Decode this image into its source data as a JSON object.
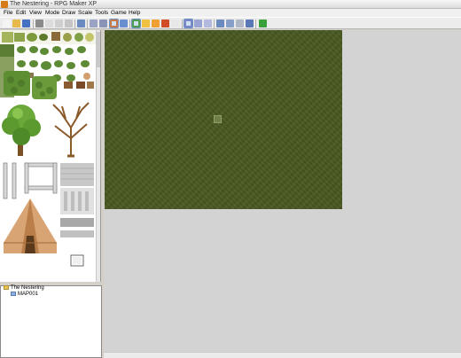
{
  "window": {
    "title": "The Nestering - RPG Maker XP"
  },
  "menu": [
    "File",
    "Edit",
    "View",
    "Mode",
    "Draw",
    "Scale",
    "Tools",
    "Game",
    "Help"
  ],
  "toolbar": {
    "buttons": [
      {
        "name": "new-project-icon",
        "color": "#f4f4f4"
      },
      {
        "name": "open-project-icon",
        "color": "#e7b84a"
      },
      {
        "name": "save-project-icon",
        "color": "#4670c0"
      },
      {
        "name": "cut-icon",
        "color": "#8a8a8a"
      },
      {
        "name": "copy-icon",
        "color": "#dcdcdc"
      },
      {
        "name": "paste-icon",
        "color": "#cfcfcf"
      },
      {
        "name": "delete-icon",
        "color": "#c4c4c4"
      },
      {
        "name": "undo-icon",
        "color": "#6a8bc0"
      },
      {
        "name": "layer1-icon",
        "color": "#9aa3c4"
      },
      {
        "name": "layer2-icon",
        "color": "#8a94b8"
      },
      {
        "name": "layer3-icon",
        "color": "#c87848"
      },
      {
        "name": "events-icon",
        "color": "#6a8fd0"
      },
      {
        "name": "pencil-icon",
        "color": "#4f9e4f"
      },
      {
        "name": "rectangle-icon",
        "color": "#f0c040"
      },
      {
        "name": "ellipse-icon",
        "color": "#f0a030"
      },
      {
        "name": "fill-icon",
        "color": "#d04c28"
      },
      {
        "name": "select-icon",
        "color": "#e8e8e8"
      },
      {
        "name": "zoom-1-icon",
        "color": "#7a86c8"
      },
      {
        "name": "zoom-2-icon",
        "color": "#9aa4d4"
      },
      {
        "name": "zoom-4-icon",
        "color": "#b3b9dc"
      },
      {
        "name": "database-icon",
        "color": "#6a8ac0"
      },
      {
        "name": "materials-icon",
        "color": "#88a0c8"
      },
      {
        "name": "scripts-icon",
        "color": "#b0b8c8"
      },
      {
        "name": "sound-test-icon",
        "color": "#5a78b8"
      },
      {
        "name": "play-test-icon",
        "color": "#3aa03a"
      }
    ]
  },
  "map_tree": {
    "root": "The Nestering",
    "children": [
      "MAP001"
    ]
  }
}
